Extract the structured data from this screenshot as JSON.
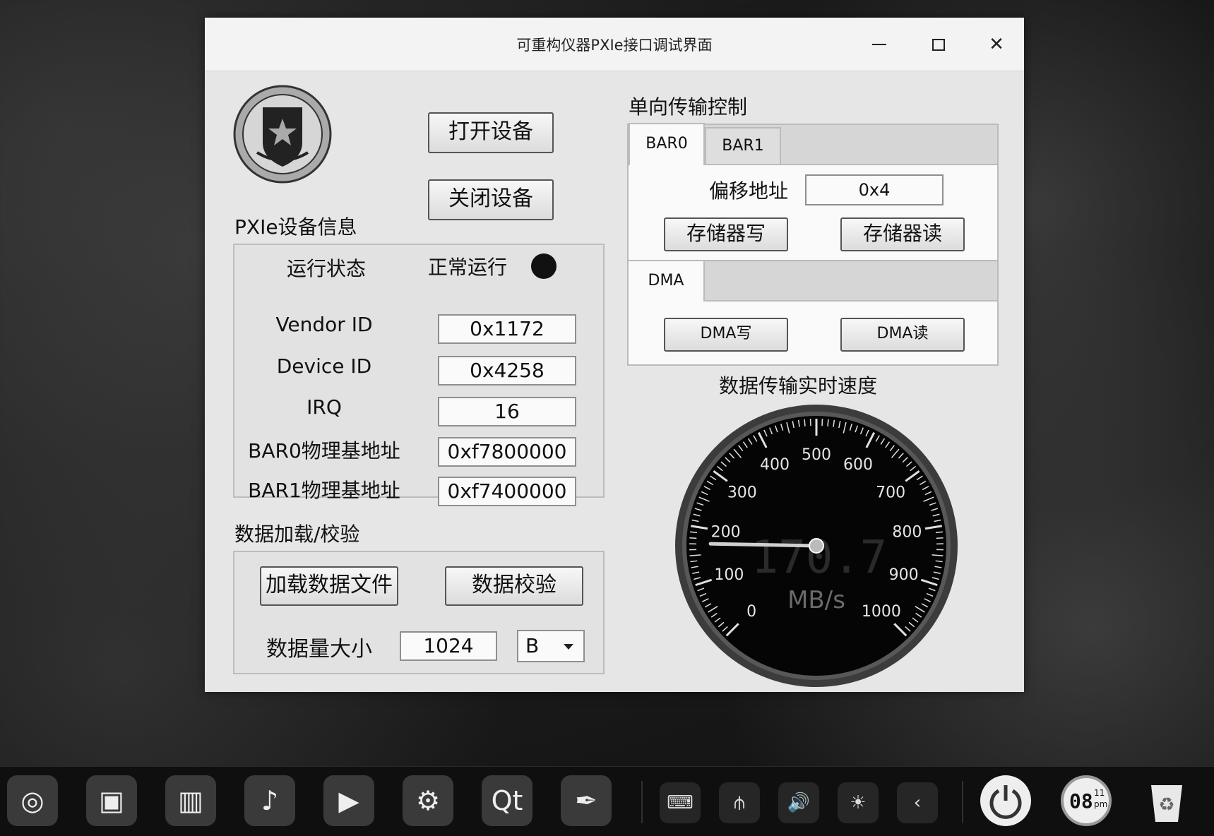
{
  "window": {
    "title": "可重构仪器PXIe接口调试界面",
    "controls": {
      "minimize": "minimize",
      "maximize": "maximize",
      "close": "✕"
    }
  },
  "device_buttons": {
    "open": "打开设备",
    "close": "关闭设备"
  },
  "device_info": {
    "heading": "PXIe设备信息",
    "status_label": "运行状态",
    "status_value": "正常运行",
    "rows": [
      {
        "label": "Vendor ID",
        "value": "0x1172"
      },
      {
        "label": "Device ID",
        "value": "0x4258"
      },
      {
        "label": "IRQ",
        "value": "16"
      },
      {
        "label": "BAR0物理基地址",
        "value": "0xf7800000"
      },
      {
        "label": "BAR1物理基地址",
        "value": "0xf7400000"
      }
    ]
  },
  "data_load": {
    "heading": "数据加载/校验",
    "load_button": "加载数据文件",
    "verify_button": "数据校验",
    "size_label": "数据量大小",
    "size_value": "1024",
    "unit_value": "B"
  },
  "transfer": {
    "heading": "单向传输控制",
    "tabs": [
      "BAR0",
      "BAR1"
    ],
    "offset_label": "偏移地址",
    "offset_value": "0x4",
    "mem_write": "存储器写",
    "mem_read": "存储器读",
    "dma_tab": "DMA",
    "dma_write": "DMA写",
    "dma_read": "DMA读"
  },
  "gauge": {
    "heading": "数据传输实时速度",
    "min": 0,
    "max": 1000,
    "value": 170.7,
    "display": "170.7",
    "unit": "MB/s",
    "ticks": [
      "0",
      "100",
      "200",
      "300",
      "400",
      "500",
      "600",
      "700",
      "800",
      "900",
      "1000"
    ]
  },
  "taskbar": {
    "apps": [
      "launcher-icon",
      "file-manager-icon",
      "app-store-icon",
      "music-icon",
      "video-icon",
      "settings-icon",
      "qt-creator-icon",
      "pen-icon"
    ],
    "tray": [
      "keyboard-icon",
      "usb-icon",
      "volume-icon",
      "brightness-icon",
      "collapse-icon"
    ],
    "clock": {
      "hours": "08",
      "minutes": "11",
      "ampm": "pm"
    }
  },
  "colors": {
    "window_bg": "#e6e6e6",
    "gauge_face": "#050505",
    "gauge_rim": "#4a4a4a",
    "desktop": "#161616"
  }
}
